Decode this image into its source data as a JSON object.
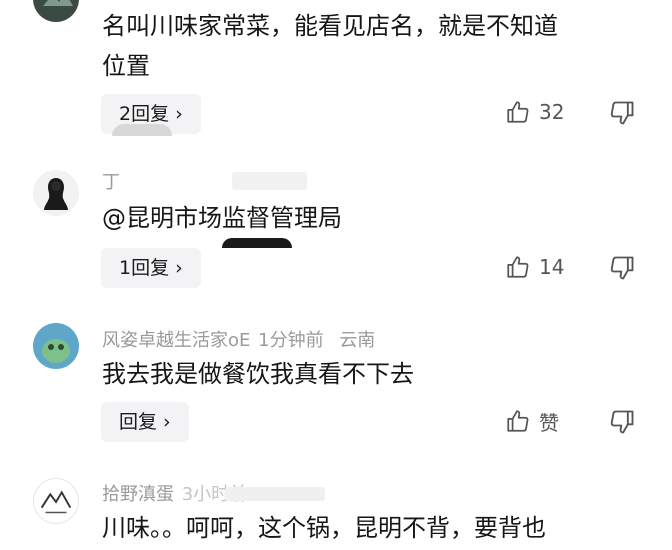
{
  "comments": [
    {
      "text_lines": [
        "名叫川味家常菜，能看见店名，就是不知道",
        "位置"
      ],
      "reply_label": "2回复",
      "likes": "32"
    },
    {
      "username": "丁",
      "text_lines": [
        "@昆明市场监督管理局"
      ],
      "reply_label": "1回复",
      "likes": "14"
    },
    {
      "username": "风姿卓越生活家oE",
      "time": "1分钟前",
      "location": "云南",
      "text_lines": [
        "我去我是做餐饮我真看不下去"
      ],
      "reply_label": "回复",
      "likes": "赞"
    },
    {
      "username": "拾野滇蛋",
      "time": "3小时前",
      "text_lines": [
        "川味。。呵呵，这个锅，昆明不背，要背也"
      ]
    }
  ],
  "icons": {
    "like": "thumbs-up-icon",
    "dislike": "thumbs-down-icon",
    "chevron": "chevron-right-icon"
  },
  "colors": {
    "text": "#161616",
    "meta": "#9a9a9a",
    "button_bg": "#f3f3f5",
    "icon": "#555555"
  }
}
